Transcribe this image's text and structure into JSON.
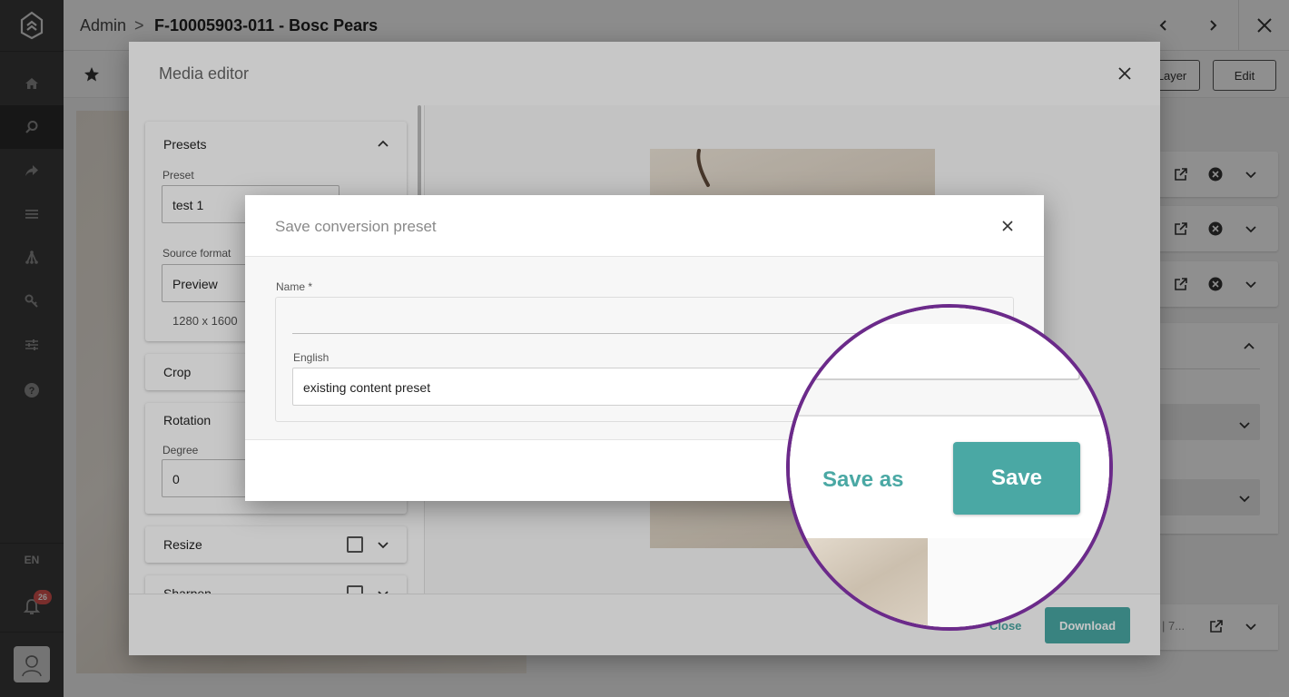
{
  "sidebar": {
    "items": [
      {
        "icon": "home-icon"
      },
      {
        "icon": "search-icon"
      },
      {
        "icon": "share-icon"
      },
      {
        "icon": "list-icon"
      },
      {
        "icon": "hierarchy-icon"
      },
      {
        "icon": "key-icon"
      },
      {
        "icon": "sliders-icon"
      },
      {
        "icon": "help-icon"
      }
    ],
    "language": "EN",
    "notifications": "26"
  },
  "header": {
    "breadcrumb_root": "Admin",
    "breadcrumb_sep": ">",
    "title": "F-10005903-011 - Bosc Pears"
  },
  "subbar": {
    "layer_label": "Layer",
    "edit_label": "Edit"
  },
  "media_editor": {
    "title": "Media editor",
    "presets": {
      "title": "Presets",
      "preset_label": "Preset",
      "preset_value": "test 1",
      "source_format_label": "Source format",
      "source_format_value": "Preview",
      "dimensions": "1280 x 1600"
    },
    "crop_label": "Crop",
    "rotation": {
      "title": "Rotation",
      "degree_label": "Degree",
      "degree_value": "0"
    },
    "resize_label": "Resize",
    "sharpen_label": "Sharpen",
    "close_label": "Close",
    "download_label": "Download"
  },
  "bg_panel_fragment": "| 7...",
  "save_dialog": {
    "title": "Save conversion preset",
    "name_label": "Name *",
    "name_value": "",
    "english_label": "English",
    "english_value": "existing content preset",
    "save_as_label": "Save as",
    "save_label": "Save"
  },
  "colors": {
    "accent": "#4aa8a4",
    "highlight_ring": "#6b2a8a",
    "sidebar_bg": "#3a3a3a"
  }
}
